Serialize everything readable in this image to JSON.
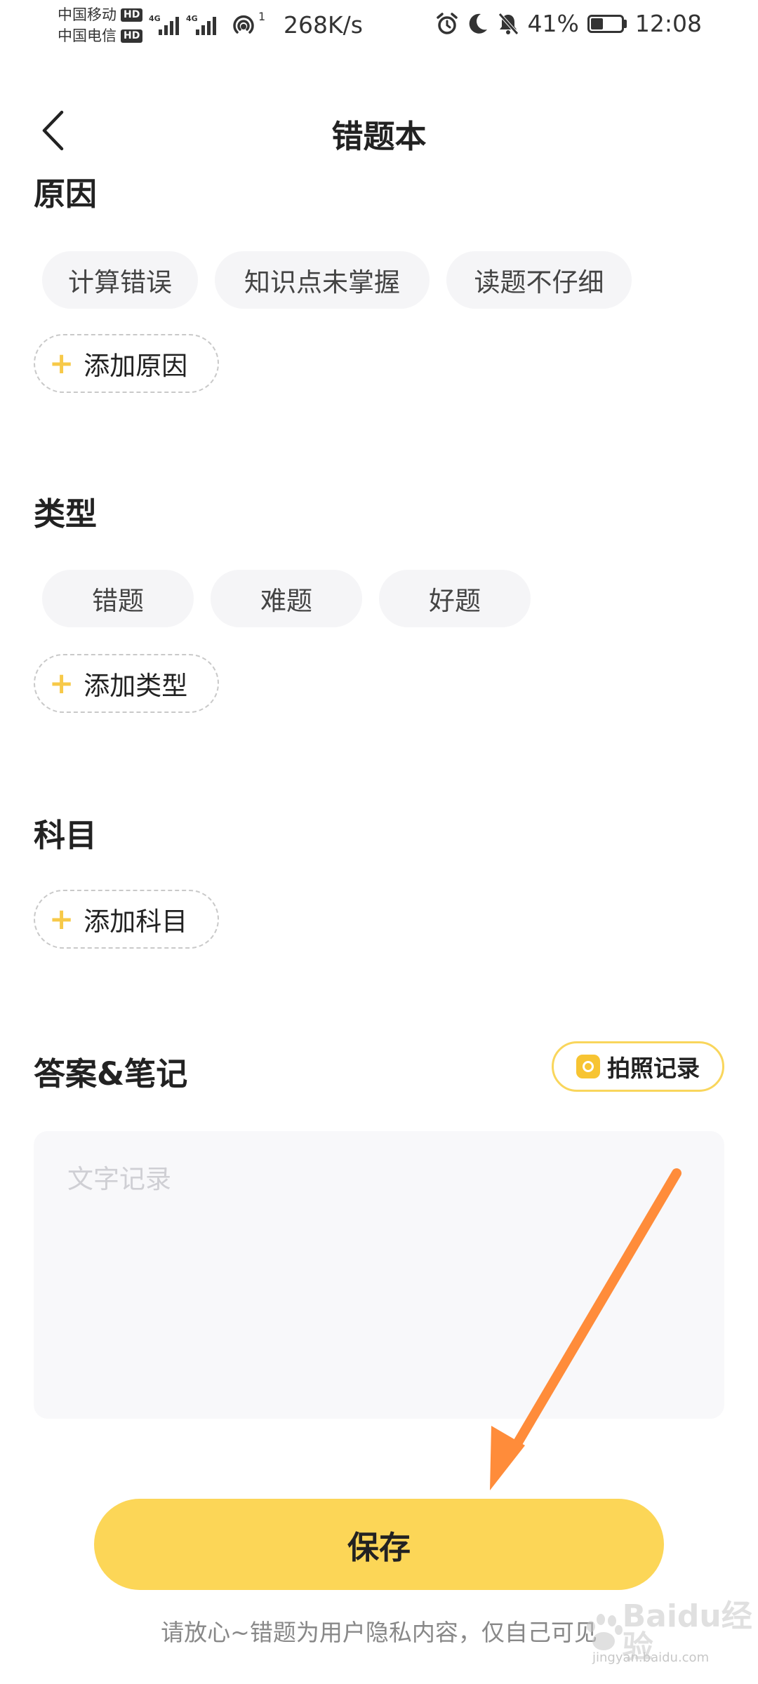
{
  "status_bar": {
    "carrier_1": "中国移动",
    "carrier_2": "中国电信",
    "hd": "HD",
    "network_gen": "4G",
    "hotspot_count": "1",
    "net_speed": "268K/s",
    "battery_level": "41%",
    "battery_fraction": 0.41,
    "time": "12:08"
  },
  "header": {
    "title": "错题本"
  },
  "reasons": {
    "title": "原因",
    "chips": [
      "计算错误",
      "知识点未掌握",
      "读题不仔细"
    ],
    "add_label": "添加原因"
  },
  "types": {
    "title": "类型",
    "chips": [
      "错题",
      "难题",
      "好题"
    ],
    "add_label": "添加类型"
  },
  "subjects": {
    "title": "科目",
    "add_label": "添加科目"
  },
  "notes": {
    "title": "答案&笔记",
    "photo_label": "拍照记录",
    "placeholder": "文字记录"
  },
  "save_label": "保存",
  "privacy_note": "请放心~错题为用户隐私内容，仅自己可见",
  "watermark": {
    "brand": "Baidu经验",
    "site": "jingyan.baidu.com"
  },
  "colors": {
    "accent": "#fcd657",
    "chip_bg": "#f5f5f7",
    "arrow": "#ff8c3a"
  }
}
